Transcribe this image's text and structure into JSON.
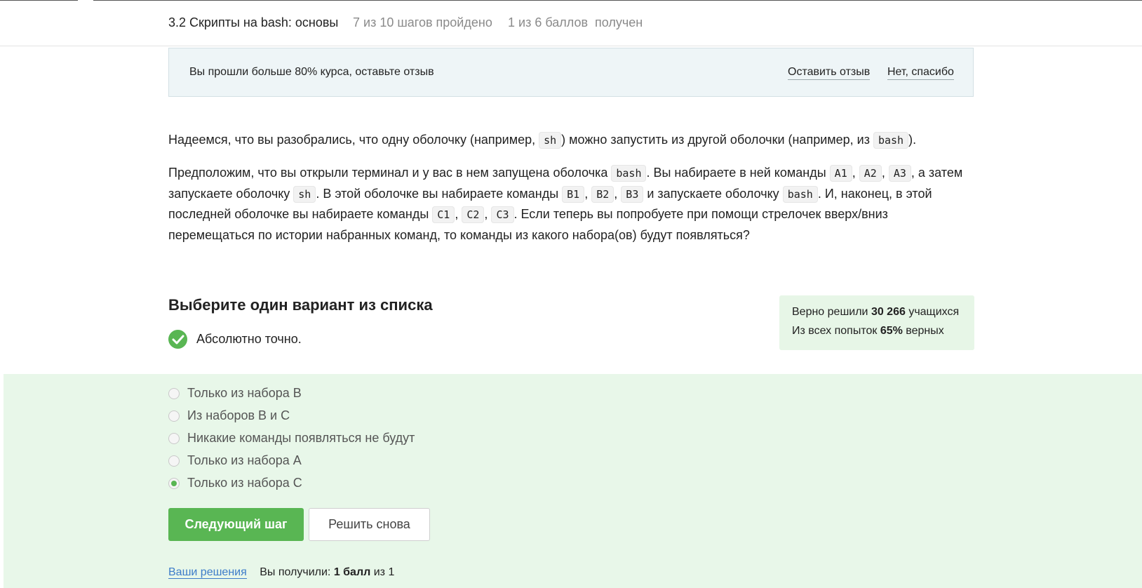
{
  "header": {
    "lesson_title": "3.2 Скрипты на bash: основы",
    "steps_progress": "7 из 10 шагов пройдено",
    "points_progress": "1 из 6 баллов  получен"
  },
  "feedback_banner": {
    "message": "Вы прошли больше 80% курса, оставьте отзыв",
    "leave_feedback": "Оставить отзыв",
    "no_thanks": "Нет, спасибо"
  },
  "content": {
    "p1": {
      "t1": "Надеемся, что вы разобрались, что одну оболочку (например, ",
      "c1": "sh",
      "t2": ") можно запустить из другой оболочки (например, из ",
      "c2": "bash",
      "t3": ")."
    },
    "p2": {
      "t1": "Предположим, что вы открыли терминал и у вас в нем запущена оболочка ",
      "c1": "bash",
      "t2": ". Вы набираете в ней команды ",
      "c2": "A1",
      "s1": ", ",
      "c3": "A2",
      "s2": ", ",
      "c4": "A3",
      "t3": ", а затем запускаете оболочку ",
      "c5": "sh",
      "t4": ". В этой оболочке вы набираете команды ",
      "c6": "B1",
      "s3": ", ",
      "c7": "B2",
      "s4": ", ",
      "c8": "B3",
      "t5": " и запускаете оболочку ",
      "c9": "bash",
      "t6": ". И, наконец, в этой последней оболочке вы набираете команды ",
      "c10": "C1",
      "s5": ", ",
      "c11": "C2",
      "s6": ", ",
      "c12": "C3",
      "t7": ". Если теперь вы попробуете при помощи стрелочек вверх/вниз перемещаться по истории набранных команд, то команды из какого набора(ов) будут появляться?"
    }
  },
  "quiz": {
    "title": "Выберите один вариант из списка",
    "result_text": "Абсолютно точно.",
    "stats": {
      "solved_prefix": "Верно решили ",
      "solved_count": "30 266",
      "solved_suffix": " учащихся",
      "attempts_prefix": "Из всех попыток ",
      "attempts_percent": "65%",
      "attempts_suffix": " верных"
    },
    "options": [
      {
        "label": "Только из набора B",
        "selected": false
      },
      {
        "label": "Из наборов B и C",
        "selected": false
      },
      {
        "label": "Никакие команды появляться не будут",
        "selected": false
      },
      {
        "label": "Только из набора A",
        "selected": false
      },
      {
        "label": "Только из набора C",
        "selected": true
      }
    ],
    "next_button": "Следующий шаг",
    "retry_button": "Решить снова",
    "footer": {
      "solutions_link": "Ваши решения",
      "received_prefix": "Вы получили: ",
      "received_value": "1 балл",
      "received_suffix": " из 1"
    }
  },
  "colors": {
    "accent_green": "#59b653",
    "answers_background": "#e8f7e9",
    "banner_background": "#eef5f7",
    "link_blue": "#3d7cc9"
  }
}
